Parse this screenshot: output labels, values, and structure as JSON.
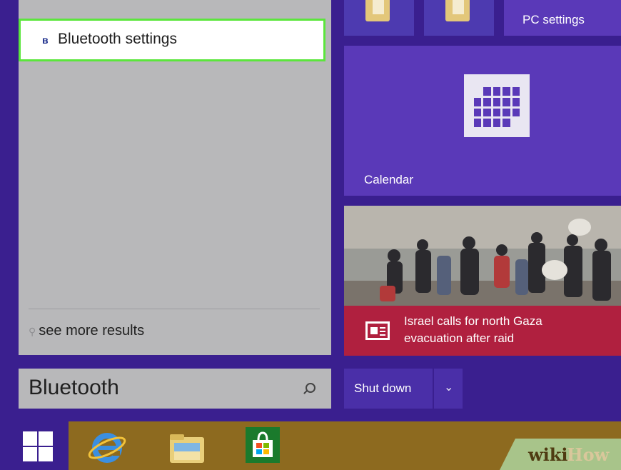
{
  "search_results": {
    "best_match": {
      "label": "Bluetooth settings",
      "icon": "bluetooth-icon"
    },
    "see_more_label": "see more results"
  },
  "search_box": {
    "value": "Bluetooth",
    "icon": "search-icon"
  },
  "tiles": {
    "pc_settings": "PC settings",
    "calendar": "Calendar",
    "news_headline_1": "Israel calls for north Gaza",
    "news_headline_2": "evacuation after raid"
  },
  "power": {
    "shutdown_label": "Shut down",
    "more_icon": "chevron-down-icon"
  },
  "taskbar": {
    "items": [
      "windows-start-icon",
      "internet-explorer-icon",
      "file-explorer-icon",
      "store-icon"
    ]
  },
  "watermark": {
    "part1": "wiki",
    "part2": "How"
  },
  "colors": {
    "background": "#3a1f8f",
    "tile": "#5a39b8",
    "news": "#b0203f",
    "highlight": "#5be63c",
    "taskbar_strip": "#8d6a1f"
  }
}
